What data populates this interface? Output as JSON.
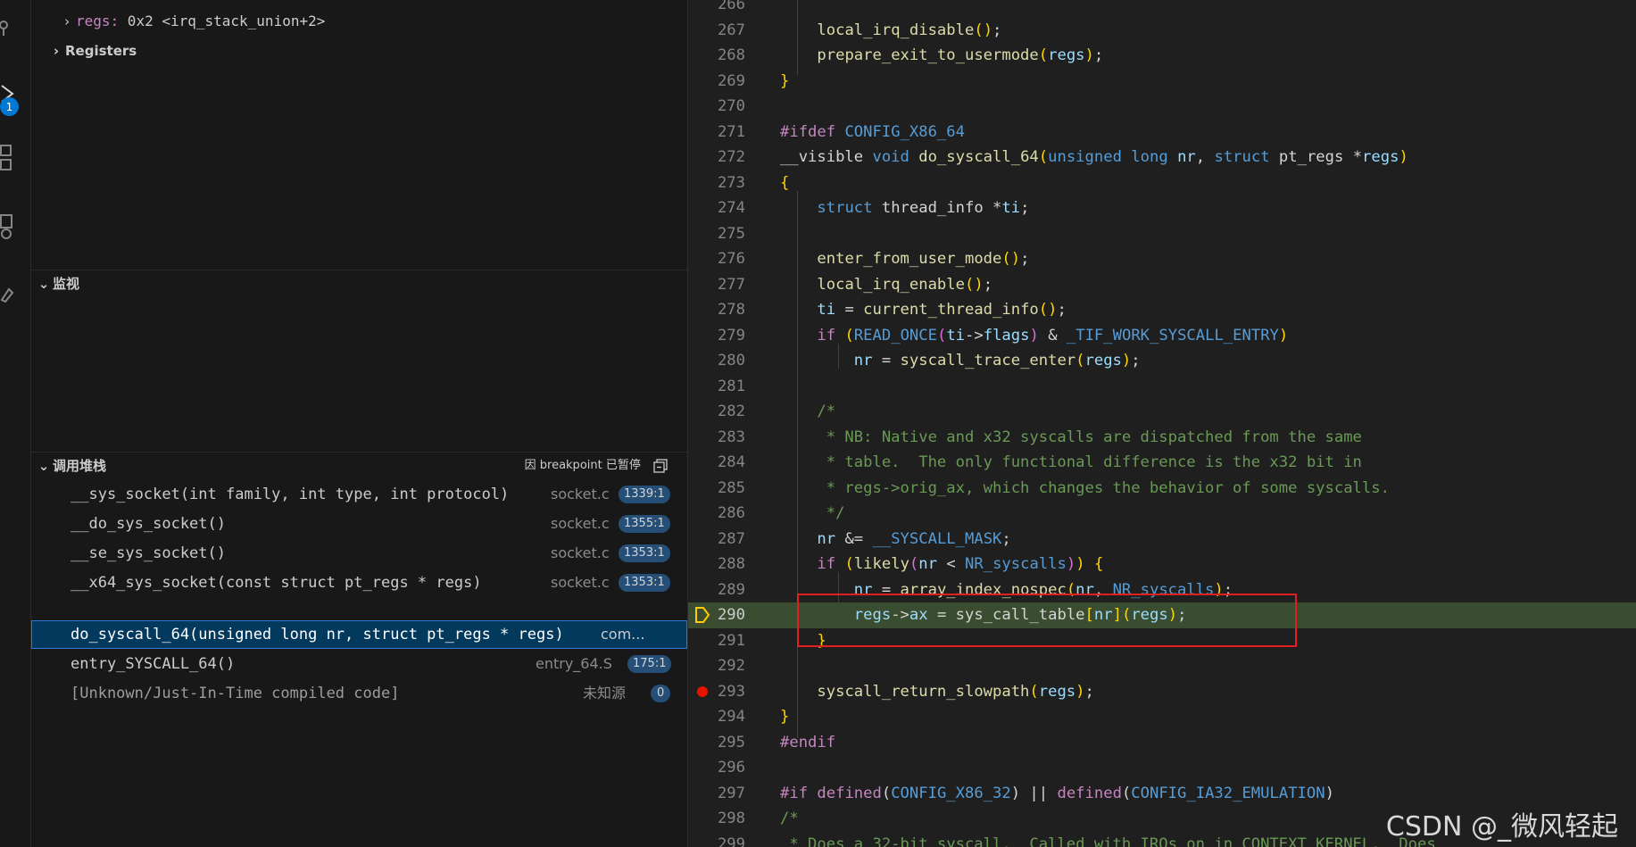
{
  "activity_bar": {
    "icons": [
      "source-control-icon",
      "run-debug-icon",
      "extensions-icon",
      "remote-explorer-icon",
      "testing-icon"
    ],
    "debug_badge": "1"
  },
  "variables": {
    "regs_name": "regs:",
    "regs_value": " 0x2 <irq_stack_union+2>",
    "registers_label": "Registers"
  },
  "watch": {
    "title": "监视"
  },
  "call_stack": {
    "title": "调用堆栈",
    "status": "因 breakpoint 已暂停",
    "frames": [
      {
        "name": "__sys_socket(int family, int type, int protocol)",
        "file": "socket.c",
        "line": "1339:1"
      },
      {
        "name": "__do_sys_socket()",
        "file": "socket.c",
        "line": "1355:1"
      },
      {
        "name": "__se_sys_socket()",
        "file": "socket.c",
        "line": "1353:1"
      },
      {
        "name": "__x64_sys_socket(const struct pt_regs * regs)",
        "file": "socket.c",
        "line": "1353:1"
      },
      {
        "name": "do_syscall_64(unsigned long nr, struct pt_regs * regs)",
        "file": "com...",
        "line": ""
      },
      {
        "name": "entry_SYSCALL_64()",
        "file": "entry_64.S",
        "line": "175:1"
      },
      {
        "name": "[Unknown/Just-In-Time compiled code]",
        "file": "未知源",
        "line": "0"
      }
    ]
  },
  "editor": {
    "current_line": 290,
    "breakpoint_line": 293,
    "lines": [
      {
        "n": "266",
        "text": ""
      },
      {
        "n": "267",
        "text": "    local_irq_disable();"
      },
      {
        "n": "268",
        "text": "    prepare_exit_to_usermode(regs);"
      },
      {
        "n": "269",
        "text": "}"
      },
      {
        "n": "270",
        "text": ""
      },
      {
        "n": "271",
        "text": "#ifdef CONFIG_X86_64"
      },
      {
        "n": "272",
        "text": "__visible void do_syscall_64(unsigned long nr, struct pt_regs *regs)"
      },
      {
        "n": "273",
        "text": "{"
      },
      {
        "n": "274",
        "text": "    struct thread_info *ti;"
      },
      {
        "n": "275",
        "text": ""
      },
      {
        "n": "276",
        "text": "    enter_from_user_mode();"
      },
      {
        "n": "277",
        "text": "    local_irq_enable();"
      },
      {
        "n": "278",
        "text": "    ti = current_thread_info();"
      },
      {
        "n": "279",
        "text": "    if (READ_ONCE(ti->flags) & _TIF_WORK_SYSCALL_ENTRY)"
      },
      {
        "n": "280",
        "text": "        nr = syscall_trace_enter(regs);"
      },
      {
        "n": "281",
        "text": ""
      },
      {
        "n": "282",
        "text": "    /*"
      },
      {
        "n": "283",
        "text": "     * NB: Native and x32 syscalls are dispatched from the same"
      },
      {
        "n": "284",
        "text": "     * table.  The only functional difference is the x32 bit in"
      },
      {
        "n": "285",
        "text": "     * regs->orig_ax, which changes the behavior of some syscalls."
      },
      {
        "n": "286",
        "text": "     */"
      },
      {
        "n": "287",
        "text": "    nr &= __SYSCALL_MASK;"
      },
      {
        "n": "288",
        "text": "    if (likely(nr < NR_syscalls)) {"
      },
      {
        "n": "289",
        "text": "        nr = array_index_nospec(nr, NR_syscalls);"
      },
      {
        "n": "290",
        "text": "        regs->ax = sys_call_table[nr](regs);"
      },
      {
        "n": "291",
        "text": "    }"
      },
      {
        "n": "292",
        "text": ""
      },
      {
        "n": "293",
        "text": "    syscall_return_slowpath(regs);"
      },
      {
        "n": "294",
        "text": "}"
      },
      {
        "n": "295",
        "text": "#endif"
      },
      {
        "n": "296",
        "text": ""
      },
      {
        "n": "297",
        "text": "#if defined(CONFIG_X86_32) || defined(CONFIG_IA32_EMULATION)"
      },
      {
        "n": "298",
        "text": "/*"
      },
      {
        "n": "299",
        "text": " * Does a 32-bit syscall.  Called with IRQs on in CONTEXT_KERNEL.  Does"
      }
    ]
  },
  "watermark": "CSDN @_微风轻起",
  "colors": {
    "accent": "#0078d4",
    "current_line_bg": "#3b4d30",
    "breakpoint": "#e51400",
    "annotation_box": "#e02020"
  }
}
